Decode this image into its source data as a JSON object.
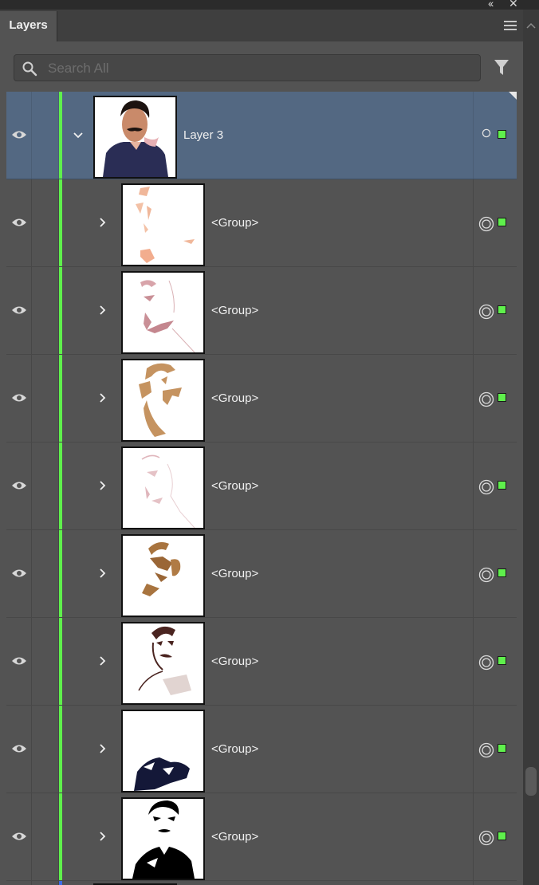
{
  "window": {
    "collapse_label": "‹‹",
    "close_label": "✕"
  },
  "panel": {
    "tab_label": "Layers"
  },
  "search": {
    "placeholder": "Search All",
    "value": ""
  },
  "layers": {
    "parent": {
      "name": "Layer 3",
      "expanded": true,
      "visible": true,
      "color": "#5ff04c"
    },
    "groups": [
      {
        "name": "<Group>",
        "thumbnail": "peach-skin-tones"
      },
      {
        "name": "<Group>",
        "thumbnail": "pink-outline-details"
      },
      {
        "name": "<Group>",
        "thumbnail": "tan-face-shading"
      },
      {
        "name": "<Group>",
        "thumbnail": "light-pink-sketch"
      },
      {
        "name": "<Group>",
        "thumbnail": "brown-face-shadows"
      },
      {
        "name": "<Group>",
        "thumbnail": "dark-brown-portrait"
      },
      {
        "name": "<Group>",
        "thumbnail": "navy-jacket"
      },
      {
        "name": "<Group>",
        "thumbnail": "black-portrait"
      }
    ],
    "next_layer_color": "#3d6be8"
  },
  "colors": {
    "panel_bg": "#535353",
    "selected_row": "#536882",
    "layer_color": "#5ff04c"
  },
  "icons": [
    "eye-icon",
    "chevron-down-icon",
    "chevron-right-icon",
    "target-circle-icon",
    "search-icon",
    "filter-icon",
    "panel-menu-icon"
  ]
}
